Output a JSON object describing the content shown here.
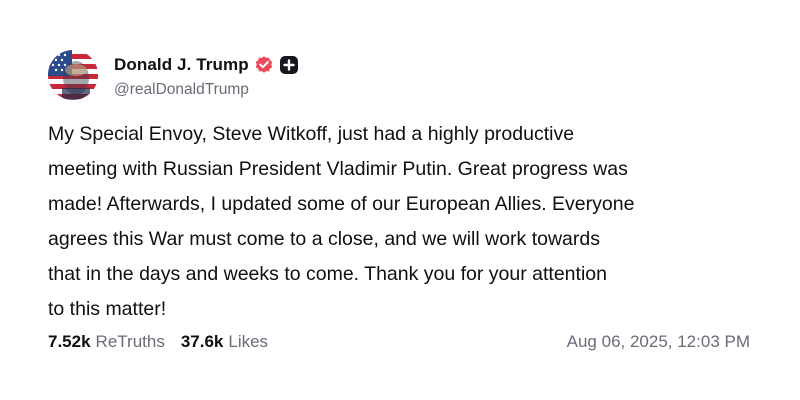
{
  "author": {
    "display_name": "Donald J. Trump",
    "handle": "@realDonaldTrump",
    "verified": true,
    "avatar_icon": "avatar-flag-portrait"
  },
  "post": {
    "lines": [
      "My Special Envoy, Steve Witkoff, just had a highly productive",
      "meeting with Russian President Vladimir Putin. Great progress was",
      "made! Afterwards, I updated some of our European Allies. Everyone",
      "agrees this War must come to a close, and we will work towards",
      "that in the days and weeks to come. Thank you for your attention",
      "to this matter!"
    ]
  },
  "stats": {
    "retruths_count": "7.52k",
    "retruths_label": "ReTruths",
    "likes_count": "37.6k",
    "likes_label": "Likes"
  },
  "timestamp": "Aug 06, 2025, 12:03 PM",
  "colors": {
    "verified_badge": "#ec4a5a",
    "plus_badge": "#16161d",
    "muted_text": "#6b6b78"
  }
}
